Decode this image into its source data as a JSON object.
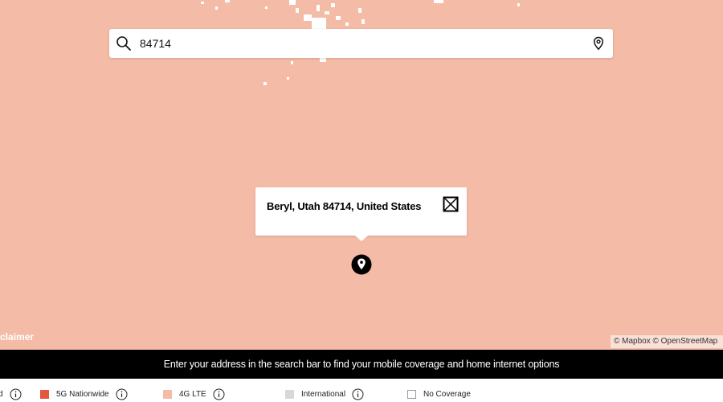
{
  "search": {
    "value": "84714",
    "icon": "search-icon",
    "location_icon": "location-pin-icon"
  },
  "popup": {
    "address": "Beryl, Utah 84714, United States",
    "close_icon": "close-icon"
  },
  "map": {
    "coverage_color": "#f4bba6",
    "marker_icon": "map-pin-icon",
    "disclaimer_label": "isclaimer",
    "attribution": "© Mapbox © OpenStreetMap"
  },
  "banner": {
    "text": "Enter your address in the search bar to find your mobile coverage and home internet options"
  },
  "legend": {
    "items": [
      {
        "label": "d",
        "color": ""
      },
      {
        "label": "5G Nationwide",
        "color": "#e5573f"
      },
      {
        "label": "4G LTE",
        "color": "#f4bba6"
      },
      {
        "label": "International",
        "color": "#d8d8d8"
      },
      {
        "label": "No Coverage",
        "color": "#ffffff"
      }
    ]
  },
  "colors": {
    "banner_bg": "#000000",
    "coverage": "#f4bba6",
    "5g_nationwide": "#e5573f"
  }
}
